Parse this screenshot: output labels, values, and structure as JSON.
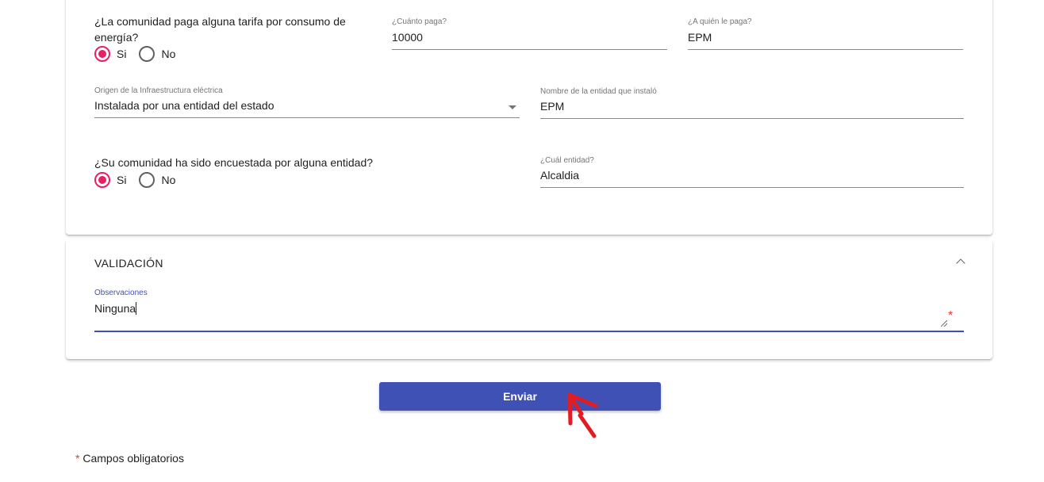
{
  "energy": {
    "tariff_question": "¿La comunidad paga alguna tarifa por consumo de energía?",
    "tariff_options": [
      "Si",
      "No"
    ],
    "tariff_selected": "Si",
    "amount_label": "¿Cuánto paga?",
    "amount_value": "10000",
    "payee_label": "¿A quién le paga?",
    "payee_value": "EPM",
    "origin_label": "Origen de la Infraestructura eléctrica",
    "origin_value": "Instalada por una entidad del estado",
    "installer_label": "Nombre de la entidad que instaló",
    "installer_value": "EPM"
  },
  "survey": {
    "question": "¿Su comunidad ha sido encuestada por alguna entidad?",
    "options": [
      "Si",
      "No"
    ],
    "selected": "Si",
    "entity_label": "¿Cuál entidad?",
    "entity_value": "Alcaldia"
  },
  "validation": {
    "title": "VALIDACIÓN",
    "observations_label": "Observaciones",
    "observations_value": "Ninguna",
    "required_mark": "*"
  },
  "actions": {
    "submit_label": "Enviar"
  },
  "footer": {
    "required_mark": "*",
    "required_note": "Campos obligatorios"
  },
  "colors": {
    "primary": "#3f51b5",
    "radio_accent": "#e91e63",
    "required": "#e53935",
    "annotation_arrow": "#e31b23"
  }
}
